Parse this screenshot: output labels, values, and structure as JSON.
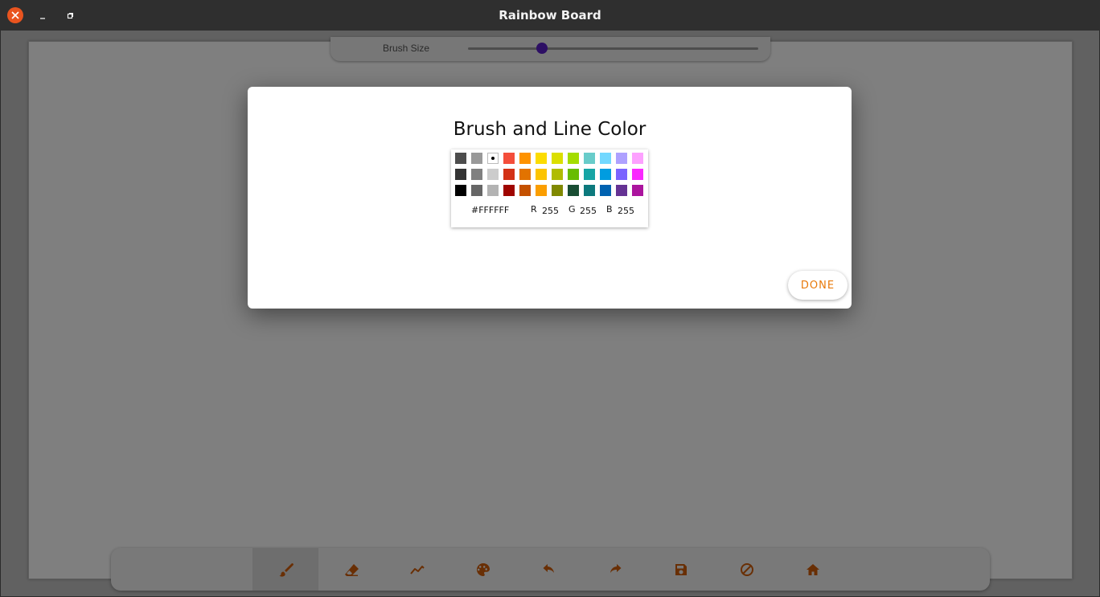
{
  "window": {
    "title": "Rainbow Board"
  },
  "brush_size": {
    "label": "Brush Size",
    "value_fraction": 0.255
  },
  "dialog": {
    "title": "Brush and Line Color",
    "done_label": "DONE",
    "selected_hex": "#FFFFFF",
    "r_label": "R",
    "r_value": "255",
    "g_label": "G",
    "g_value": "255",
    "b_label": "B",
    "b_value": "255",
    "swatches": [
      [
        "#4d4d4d",
        "#999999",
        "#ffffff",
        "#f44e3b",
        "#fe9200",
        "#fcdc00",
        "#dbdf00",
        "#a4dd00",
        "#68ccca",
        "#73d8ff",
        "#aea1ff",
        "#fda1ff"
      ],
      [
        "#333333",
        "#808080",
        "#cccccc",
        "#d33115",
        "#e27300",
        "#fcc400",
        "#b0bc00",
        "#68bc00",
        "#16a5a5",
        "#009ce0",
        "#7b64ff",
        "#fa28ff"
      ],
      [
        "#000000",
        "#666666",
        "#b3b3b3",
        "#9f0500",
        "#c45100",
        "#fb9e00",
        "#808900",
        "#194d33",
        "#0c797d",
        "#0062b1",
        "#653294",
        "#ab149e"
      ]
    ],
    "selected_swatch": [
      0,
      2
    ]
  },
  "toolbar": {
    "tools": [
      {
        "name": "brush-icon",
        "active": true
      },
      {
        "name": "eraser-icon",
        "active": false
      },
      {
        "name": "line-icon",
        "active": false
      },
      {
        "name": "palette-icon",
        "active": false
      },
      {
        "name": "undo-icon",
        "active": false
      },
      {
        "name": "redo-icon",
        "active": false
      },
      {
        "name": "save-icon",
        "active": false
      },
      {
        "name": "clear-icon",
        "active": false
      },
      {
        "name": "home-icon",
        "active": false
      }
    ],
    "accent_color": "#d35e0a"
  }
}
